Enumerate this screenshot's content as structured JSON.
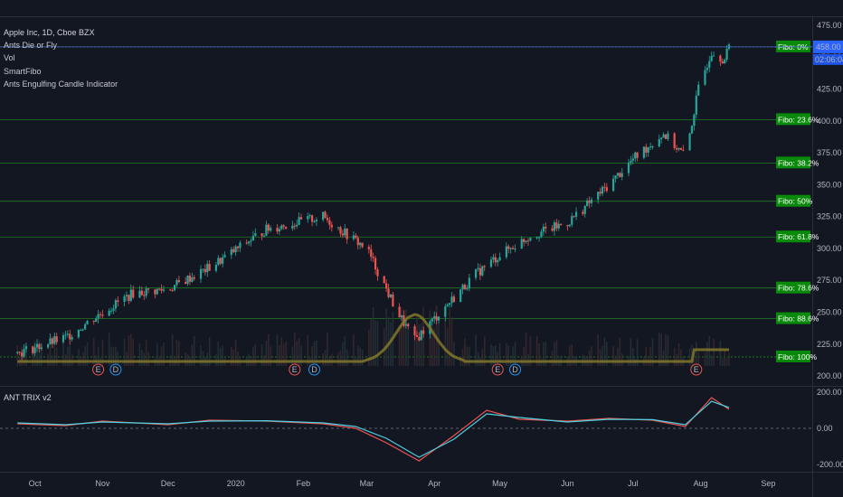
{
  "legend": {
    "title": "Apple Inc, 1D, Cboe BZX",
    "items": [
      "Ants Die or Fly",
      "Vol",
      "SmartFibo",
      "Ants Engulfing Candle Indicator"
    ]
  },
  "lower_pane_title": "ANT TRIX v2",
  "price_badges": {
    "price": "458.00",
    "countdown": "02:06:04"
  },
  "colors": {
    "bg": "#131722",
    "up": "#26a69a",
    "down": "#ef5350",
    "fibo_line": "#1e7a1e",
    "fibo_label_bg": "#0a8a0a",
    "badge": "#2962ff",
    "ma": "#8a7d2a"
  },
  "chart_data": [
    {
      "type": "candlestick",
      "title": "Apple Inc, 1D, Cboe BZX",
      "ylim": [
        193,
        482
      ],
      "y_ticks": [
        "475.00",
        "450.00",
        "425.00",
        "400.00",
        "375.00",
        "350.00",
        "325.00",
        "300.00",
        "275.00",
        "250.00",
        "225.00",
        "200.00"
      ],
      "x_ticks": [
        "Oct",
        "Nov",
        "Dec",
        "2020",
        "Feb",
        "Mar",
        "Apr",
        "May",
        "Jun",
        "Jul",
        "Aug",
        "Sep"
      ],
      "close_trend": [
        {
          "date": "2019-09-23",
          "close": 218
        },
        {
          "date": "2019-10-15",
          "close": 230
        },
        {
          "date": "2019-11-01",
          "close": 250
        },
        {
          "date": "2019-11-15",
          "close": 265
        },
        {
          "date": "2019-12-01",
          "close": 268
        },
        {
          "date": "2019-12-20",
          "close": 285
        },
        {
          "date": "2020-01-15",
          "close": 315
        },
        {
          "date": "2020-02-10",
          "close": 325
        },
        {
          "date": "2020-02-20",
          "close": 312
        },
        {
          "date": "2020-03-01",
          "close": 300
        },
        {
          "date": "2020-03-15",
          "close": 250
        },
        {
          "date": "2020-03-23",
          "close": 228
        },
        {
          "date": "2020-04-01",
          "close": 245
        },
        {
          "date": "2020-04-20",
          "close": 280
        },
        {
          "date": "2020-05-01",
          "close": 295
        },
        {
          "date": "2020-05-15",
          "close": 310
        },
        {
          "date": "2020-06-01",
          "close": 320
        },
        {
          "date": "2020-06-20",
          "close": 350
        },
        {
          "date": "2020-07-01",
          "close": 370
        },
        {
          "date": "2020-07-15",
          "close": 390
        },
        {
          "date": "2020-07-25",
          "close": 372
        },
        {
          "date": "2020-07-31",
          "close": 425
        },
        {
          "date": "2020-08-06",
          "close": 455
        },
        {
          "date": "2020-08-12",
          "close": 448
        },
        {
          "date": "2020-08-14",
          "close": 458
        }
      ],
      "fibo_levels": [
        {
          "label": "Fibo:   0%",
          "price": 458.0
        },
        {
          "label": "Fibo: 23.6%",
          "price": 401.0
        },
        {
          "label": "Fibo: 38.2%",
          "price": 367.0
        },
        {
          "label": "Fibo:   50%",
          "price": 337.0
        },
        {
          "label": "Fibo: 61.8%",
          "price": 309.0
        },
        {
          "label": "Fibo: 78.6%",
          "price": 269.0
        },
        {
          "label": "Fibo: 88.6%",
          "price": 245.0
        },
        {
          "label": "Fibo: 100%",
          "price": 215.0
        }
      ],
      "events": [
        {
          "date": "2019-10-30",
          "label": "E"
        },
        {
          "date": "2019-11-07",
          "label": "D"
        },
        {
          "date": "2020-01-28",
          "label": "E"
        },
        {
          "date": "2020-02-06",
          "label": "D"
        },
        {
          "date": "2020-04-30",
          "label": "E"
        },
        {
          "date": "2020-05-08",
          "label": "D"
        },
        {
          "date": "2020-07-30",
          "label": "E"
        }
      ]
    },
    {
      "type": "line",
      "title": "ANT TRIX v2",
      "ylim": [
        -230,
        230
      ],
      "y_ticks": [
        "200.00",
        "0.00",
        "-200.00"
      ],
      "series": [
        {
          "color": "#ef5350",
          "values": [
            {
              "date": "2019-09-23",
              "value": 25
            },
            {
              "date": "2019-10-15",
              "value": 15
            },
            {
              "date": "2019-11-01",
              "value": 40
            },
            {
              "date": "2019-12-01",
              "value": 20
            },
            {
              "date": "2019-12-20",
              "value": 45
            },
            {
              "date": "2020-01-15",
              "value": 40
            },
            {
              "date": "2020-02-10",
              "value": 25
            },
            {
              "date": "2020-02-25",
              "value": 0
            },
            {
              "date": "2020-03-10",
              "value": -80
            },
            {
              "date": "2020-03-25",
              "value": -180
            },
            {
              "date": "2020-04-10",
              "value": -40
            },
            {
              "date": "2020-04-25",
              "value": 100
            },
            {
              "date": "2020-05-10",
              "value": 50
            },
            {
              "date": "2020-06-01",
              "value": 40
            },
            {
              "date": "2020-06-20",
              "value": 55
            },
            {
              "date": "2020-07-10",
              "value": 45
            },
            {
              "date": "2020-07-25",
              "value": 10
            },
            {
              "date": "2020-08-06",
              "value": 170
            },
            {
              "date": "2020-08-14",
              "value": 105
            }
          ]
        },
        {
          "color": "#4dd0e1",
          "values": [
            {
              "date": "2019-09-23",
              "value": 30
            },
            {
              "date": "2019-10-15",
              "value": 20
            },
            {
              "date": "2019-11-01",
              "value": 35
            },
            {
              "date": "2019-12-01",
              "value": 25
            },
            {
              "date": "2019-12-20",
              "value": 40
            },
            {
              "date": "2020-01-15",
              "value": 42
            },
            {
              "date": "2020-02-10",
              "value": 30
            },
            {
              "date": "2020-02-25",
              "value": 10
            },
            {
              "date": "2020-03-10",
              "value": -55
            },
            {
              "date": "2020-03-25",
              "value": -160
            },
            {
              "date": "2020-04-10",
              "value": -60
            },
            {
              "date": "2020-04-25",
              "value": 80
            },
            {
              "date": "2020-05-10",
              "value": 60
            },
            {
              "date": "2020-06-01",
              "value": 35
            },
            {
              "date": "2020-06-20",
              "value": 50
            },
            {
              "date": "2020-07-10",
              "value": 48
            },
            {
              "date": "2020-07-25",
              "value": 20
            },
            {
              "date": "2020-08-06",
              "value": 150
            },
            {
              "date": "2020-08-14",
              "value": 115
            }
          ]
        }
      ]
    }
  ]
}
